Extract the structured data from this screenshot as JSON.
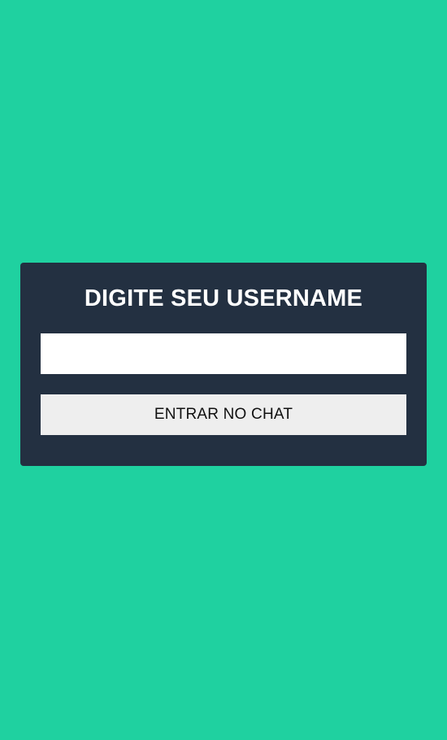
{
  "login_card": {
    "title": "DIGITE SEU USERNAME",
    "username_input": {
      "value": "",
      "placeholder": ""
    },
    "enter_button_label": "ENTRAR NO CHAT"
  },
  "colors": {
    "background": "#1FD1A0",
    "card": "#233041",
    "input": "#FFFFFF",
    "button": "#EEEEEE"
  }
}
